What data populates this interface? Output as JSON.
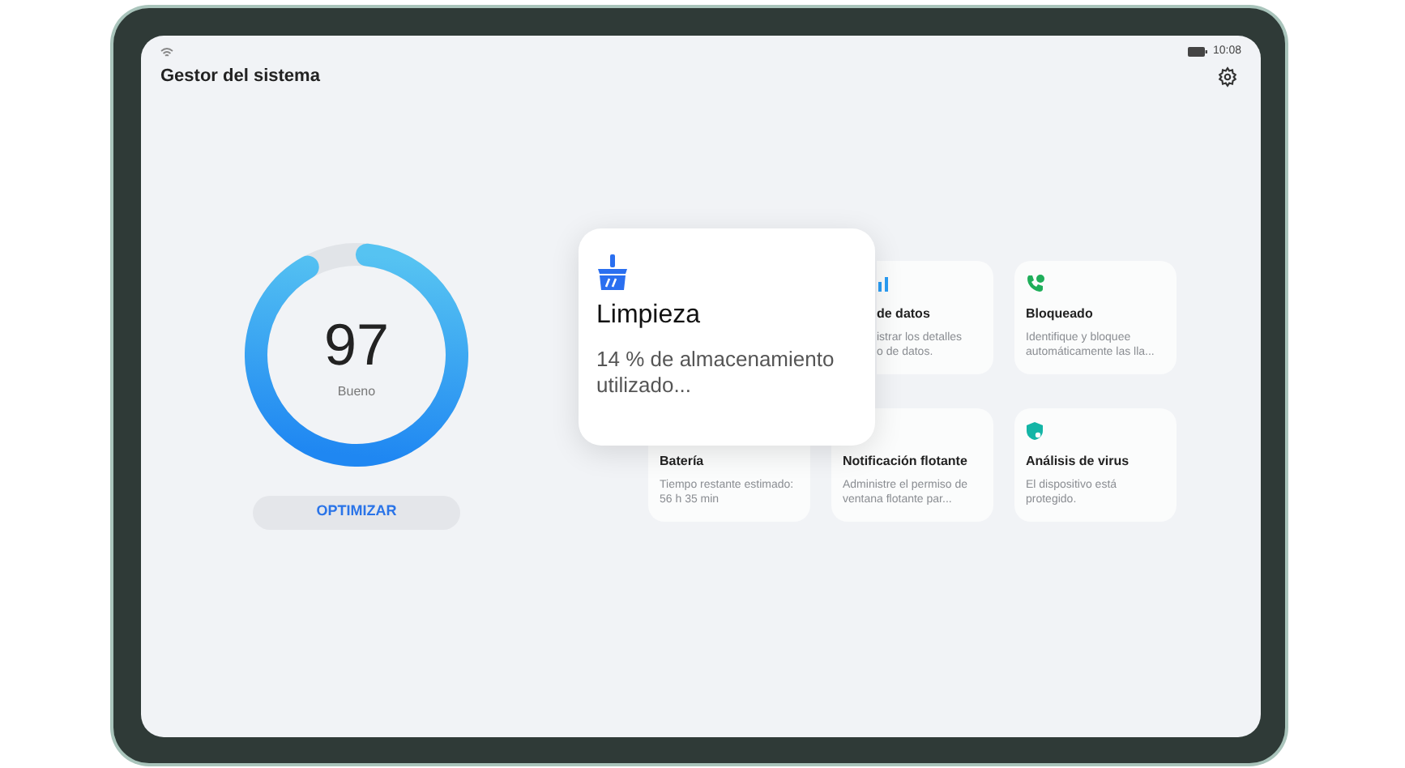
{
  "status_bar": {
    "time": "10:08"
  },
  "title": "Gestor del sistema",
  "score": {
    "value": "97",
    "label": "Bueno",
    "level": 0.97
  },
  "optimize_button": "OPTIMIZAR",
  "cards": [
    {
      "kind": "data",
      "title": "de datos",
      "description": "istrar los detalles\no de datos."
    },
    {
      "kind": "call",
      "title": "Bloqueado",
      "description": "Identifique y bloquee automáticamente las lla..."
    },
    {
      "kind": "battery",
      "title": "Batería",
      "description": "Tiempo restante estimado: 56 h 35 min"
    },
    {
      "kind": "floating",
      "title": "Notificación flotante",
      "description": "Administre el permiso de ventana flotante par..."
    },
    {
      "kind": "virus",
      "title": "Análisis de virus",
      "description": "El dispositivo está protegido."
    }
  ],
  "popup": {
    "title": "Limpieza",
    "description": "14 % de almacenamiento utilizado..."
  }
}
